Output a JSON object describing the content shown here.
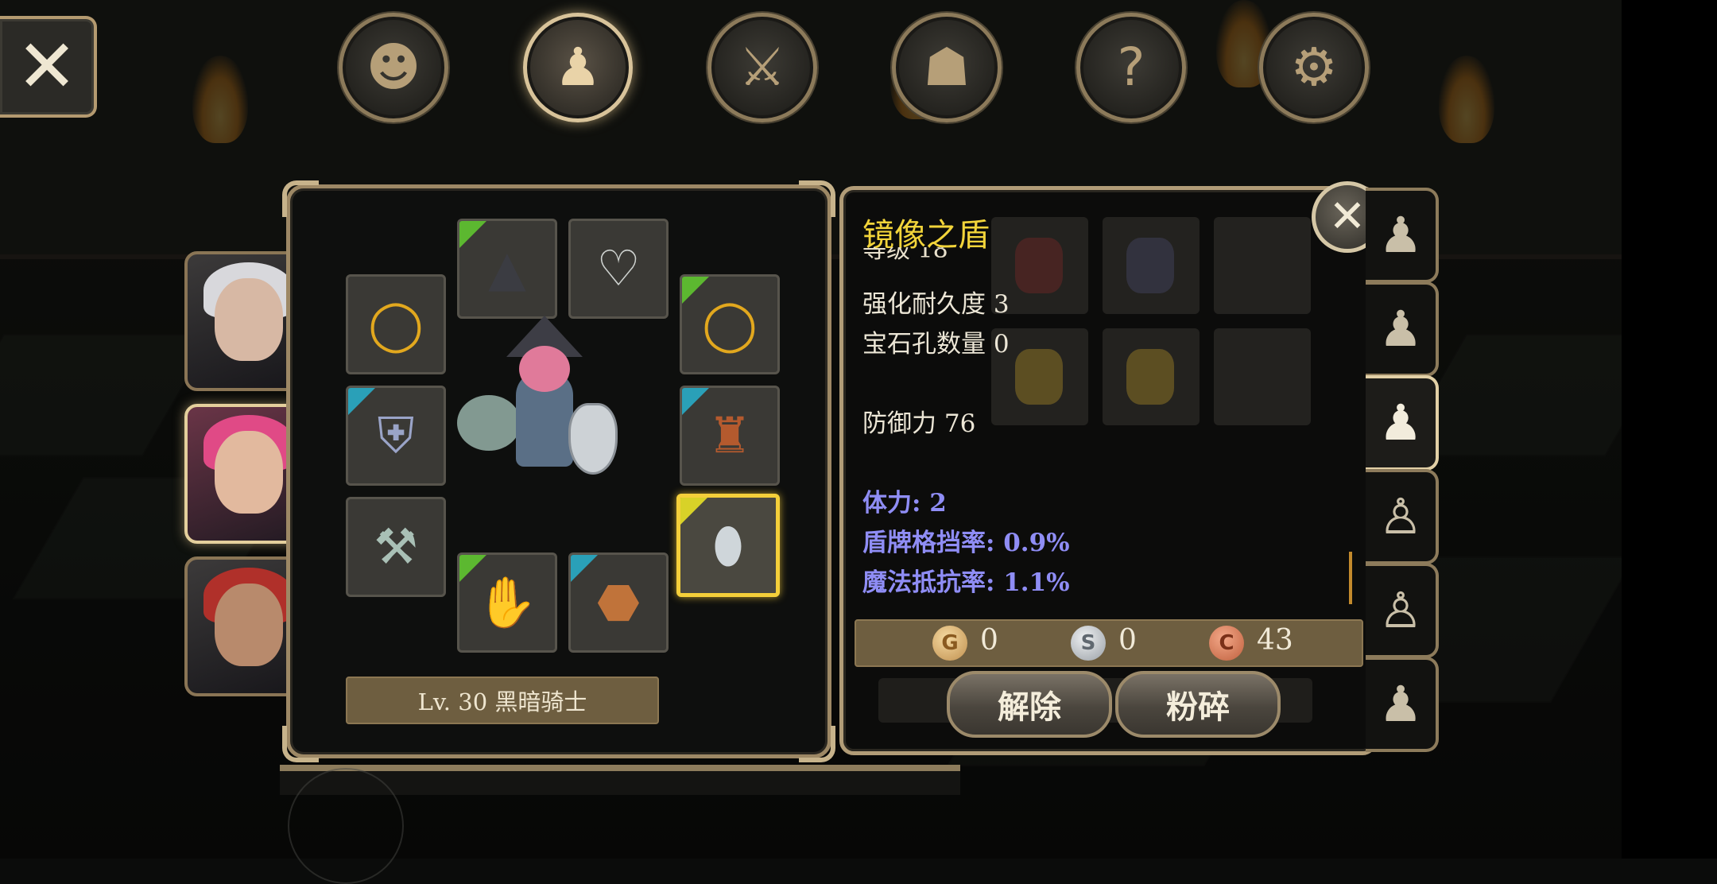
{
  "nav": {
    "close_icon": "close-x-icon",
    "tabs": [
      {
        "name": "profile",
        "icon": "head-icon",
        "active": false
      },
      {
        "name": "inventory",
        "icon": "bag-icon",
        "active": true
      },
      {
        "name": "skills",
        "icon": "sword-compass-icon",
        "active": false
      },
      {
        "name": "party",
        "icon": "people-icon",
        "active": false
      },
      {
        "name": "quests",
        "icon": "scroll-question-icon",
        "active": false
      },
      {
        "name": "settings",
        "icon": "gear-icon",
        "active": false
      }
    ]
  },
  "characters": [
    {
      "name": "white-haired-hero",
      "active": false
    },
    {
      "name": "pink-haired-knight",
      "active": true
    },
    {
      "name": "red-haired-warrior",
      "active": false
    }
  ],
  "equipment": {
    "slots": [
      {
        "slot": "hat",
        "icon": "witch-hat-icon",
        "rarity": "green"
      },
      {
        "slot": "necklace",
        "icon": "necklace-icon",
        "rarity": "none"
      },
      {
        "slot": "ring-left",
        "icon": "gold-ring-icon",
        "rarity": "none"
      },
      {
        "slot": "ring-right",
        "icon": "gold-ring-icon",
        "rarity": "green"
      },
      {
        "slot": "armor",
        "icon": "armor-icon",
        "rarity": "blue"
      },
      {
        "slot": "cloak",
        "icon": "cloak-icon",
        "rarity": "blue"
      },
      {
        "slot": "weapon",
        "icon": "axe-icon",
        "rarity": "none"
      },
      {
        "slot": "shield",
        "icon": "mirror-shield-icon",
        "rarity": "yellow",
        "selected": true
      },
      {
        "slot": "gloves",
        "icon": "gloves-icon",
        "rarity": "green"
      },
      {
        "slot": "boots",
        "icon": "boots-icon",
        "rarity": "blue"
      }
    ],
    "level_class": "Lv. 30 黑暗骑士"
  },
  "item": {
    "name": "镜像之盾",
    "cut_line": "等级 18",
    "durability": "强化耐久度 3",
    "gem_slots": "宝石孔数量 0",
    "defense": "防御力 76",
    "bonuses": [
      "体力: 2",
      "盾牌格挡率: 0.9%",
      "魔法抵抗率: 1.1%"
    ],
    "currency": [
      {
        "type": "gold",
        "symbol": "G",
        "value": "0"
      },
      {
        "type": "silver",
        "symbol": "S",
        "value": "0"
      },
      {
        "type": "copper",
        "symbol": "C",
        "value": "43"
      }
    ],
    "buttons": {
      "unequip": "解除",
      "smash": "粉碎"
    }
  },
  "colors": {
    "item_name": "#f2d43a",
    "bonus_text": "#8f8df5",
    "frame": "#b19c77"
  }
}
